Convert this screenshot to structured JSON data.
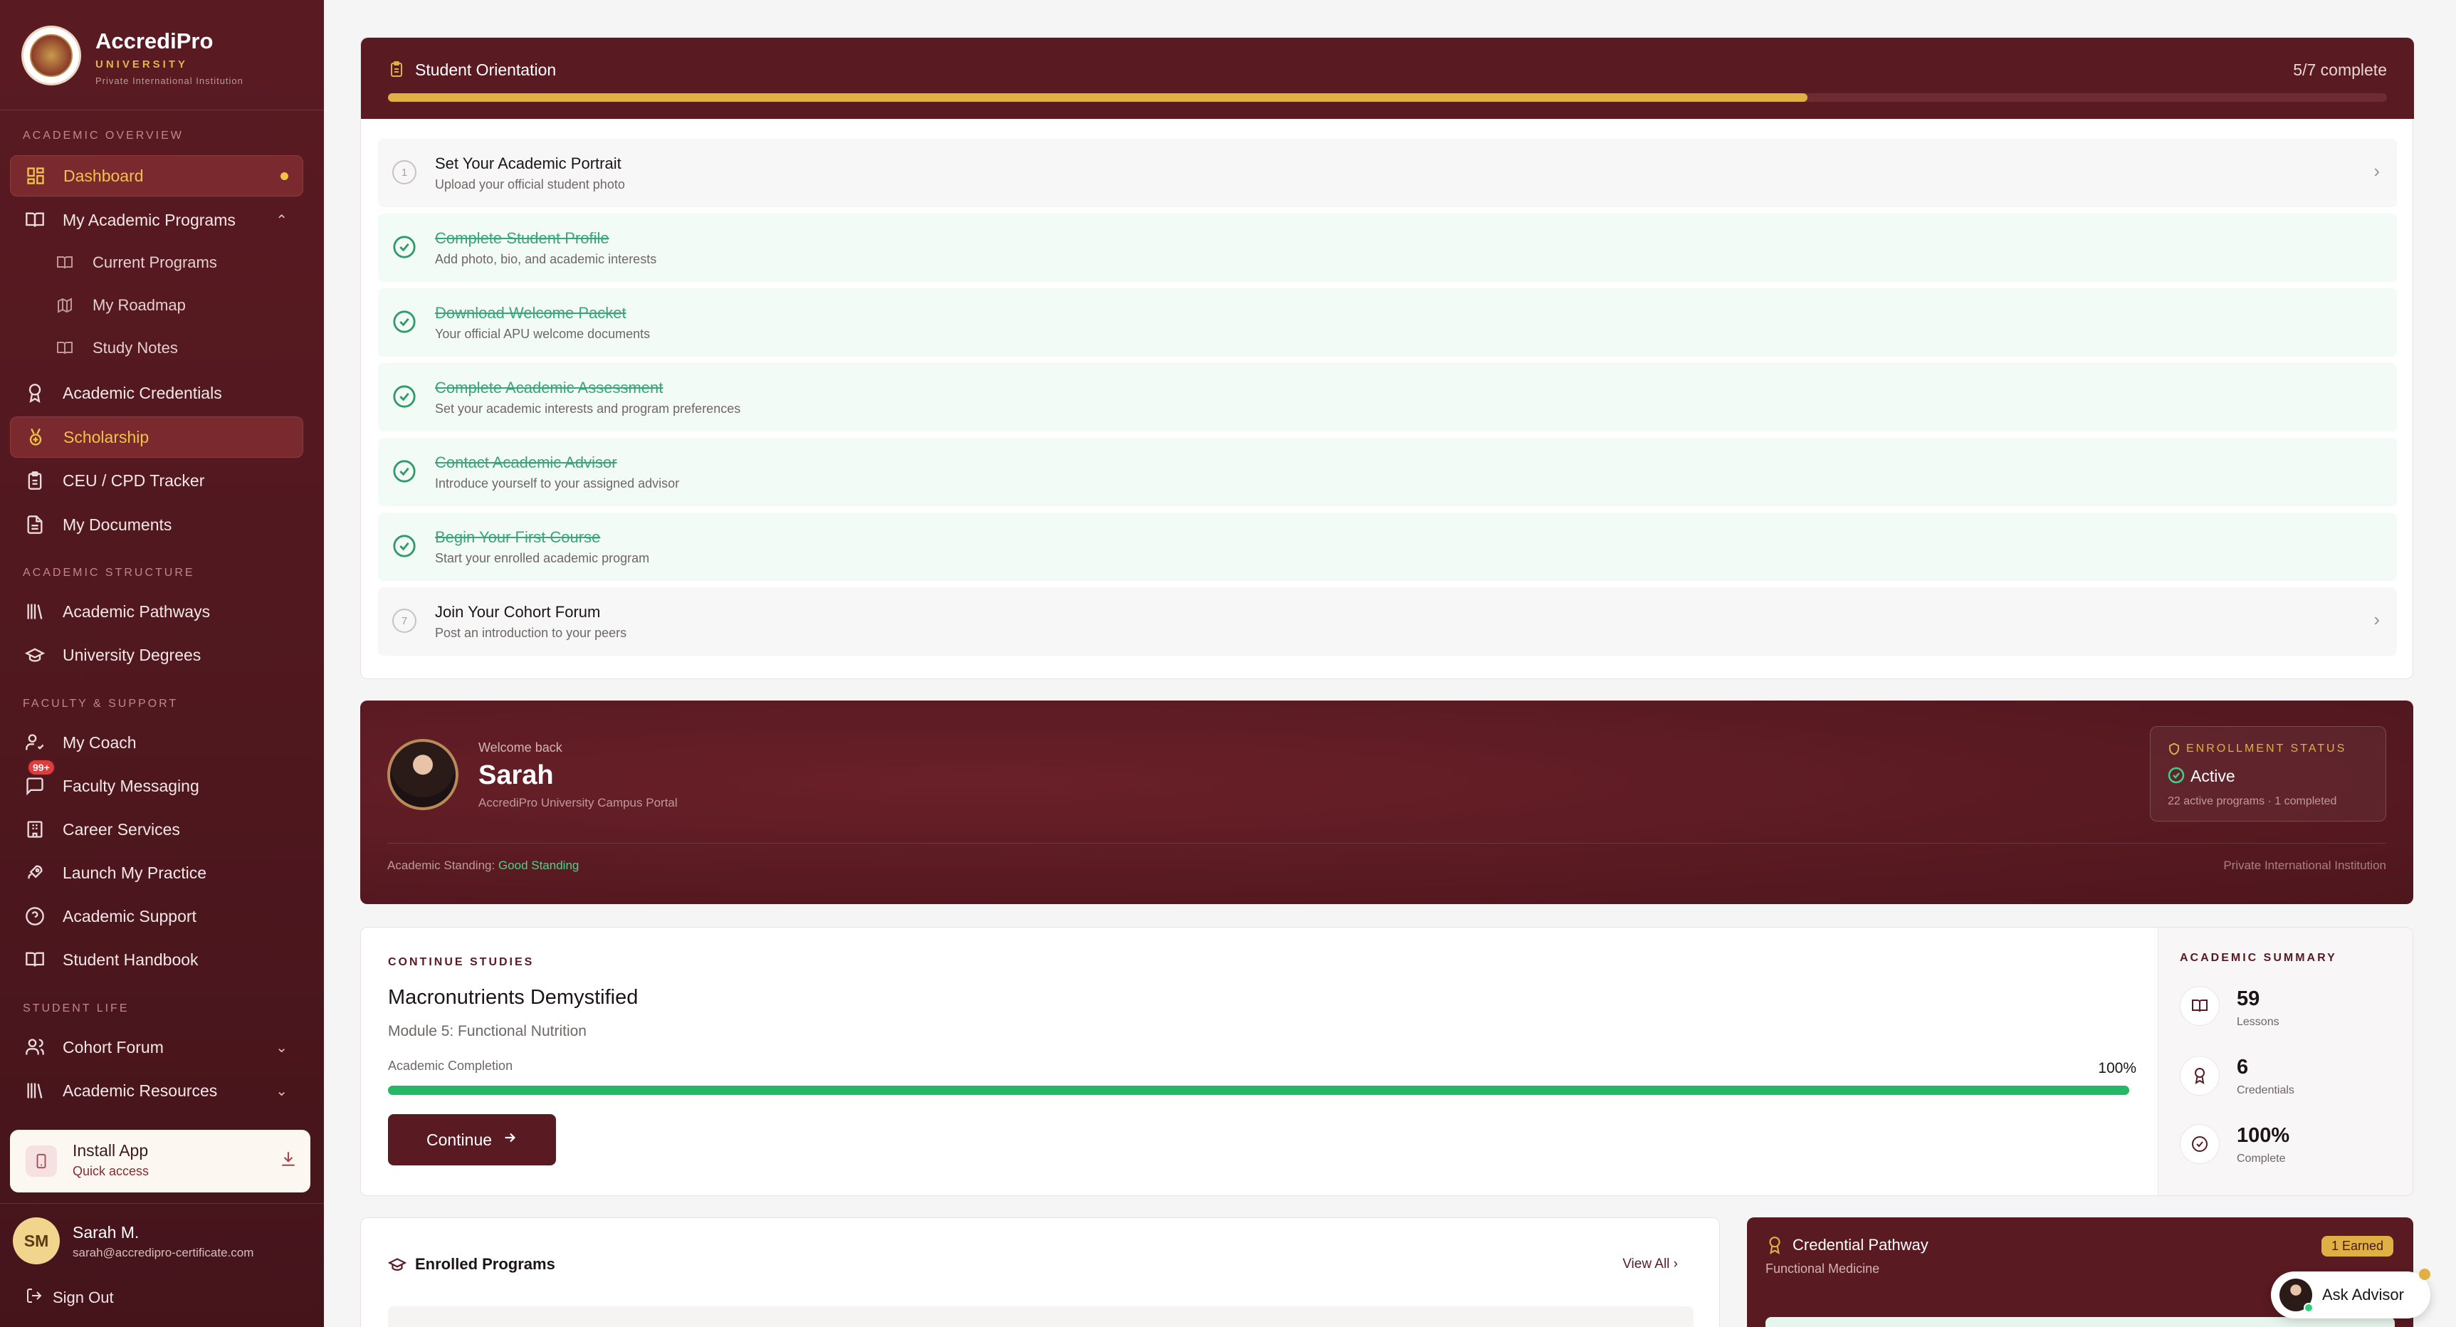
{
  "brand": {
    "name": "AccrediPro",
    "subtitle": "UNIVERSITY",
    "tagline": "Private International Institution"
  },
  "sidebar": {
    "sections": {
      "overview": "ACADEMIC OVERVIEW",
      "structure": "ACADEMIC STRUCTURE",
      "faculty": "FACULTY & SUPPORT",
      "life": "STUDENT LIFE"
    },
    "items": {
      "dashboard": "Dashboard",
      "programs": "My Academic Programs",
      "current": "Current Programs",
      "roadmap": "My Roadmap",
      "notes": "Study Notes",
      "credentials": "Academic Credentials",
      "scholarship": "Scholarship",
      "ceu": "CEU / CPD Tracker",
      "documents": "My Documents",
      "pathways": "Academic Pathways",
      "degrees": "University Degrees",
      "coach": "My Coach",
      "messaging": "Faculty Messaging",
      "career": "Career Services",
      "practice": "Launch My Practice",
      "support": "Academic Support",
      "handbook": "Student Handbook",
      "forum": "Cohort Forum",
      "resources": "Academic Resources"
    },
    "messaging_badge": "99+",
    "install": {
      "title": "Install App",
      "subtitle": "Quick access"
    },
    "user": {
      "initials": "SM",
      "name": "Sarah M.",
      "email": "sarah@accredipro-certificate.com"
    },
    "signout": "Sign Out"
  },
  "orientation": {
    "title": "Student Orientation",
    "count": "5/7 complete",
    "progress": 0.71,
    "tasks": [
      {
        "num": "1",
        "title": "Set Your Academic Portrait",
        "desc": "Upload your official student photo",
        "done": false
      },
      {
        "title": "Complete Student Profile",
        "desc": "Add photo, bio, and academic interests",
        "done": true
      },
      {
        "title": "Download Welcome Packet",
        "desc": "Your official APU welcome documents",
        "done": true
      },
      {
        "title": "Complete Academic Assessment",
        "desc": "Set your academic interests and program preferences",
        "done": true
      },
      {
        "title": "Contact Academic Advisor",
        "desc": "Introduce yourself to your assigned advisor",
        "done": true
      },
      {
        "title": "Begin Your First Course",
        "desc": "Start your enrolled academic program",
        "done": true
      },
      {
        "num": "7",
        "title": "Join Your Cohort Forum",
        "desc": "Post an introduction to your peers",
        "done": false
      }
    ]
  },
  "welcome": {
    "greeting": "Welcome back",
    "name": "Sarah",
    "portal": "AccrediPro University Campus Portal",
    "standing_label": "Academic Standing:",
    "standing_value": "Good Standing",
    "institution": "Private International Institution",
    "enrollment": {
      "heading": "ENROLLMENT STATUS",
      "status": "Active",
      "detail": "22 active programs · 1 completed"
    }
  },
  "continue_studies": {
    "heading": "CONTINUE STUDIES",
    "course": "Macronutrients Demystified",
    "module": "Module 5: Functional Nutrition",
    "completion_label": "Academic Completion",
    "completion_pct": "100%",
    "completion": 1.0,
    "button": "Continue"
  },
  "summary": {
    "heading": "ACADEMIC SUMMARY",
    "stats": [
      {
        "value": "59",
        "label": "Lessons"
      },
      {
        "value": "6",
        "label": "Credentials"
      },
      {
        "value": "100%",
        "label": "Complete"
      }
    ]
  },
  "enrolled": {
    "title": "Enrolled Programs",
    "view_all": "View All"
  },
  "credential_pathway": {
    "title": "Credential Pathway",
    "subtitle": "Functional Medicine",
    "badge": "1 Earned"
  },
  "ask_advisor": "Ask Advisor",
  "colors": {
    "maroon": "#5a1a22",
    "gold": "#e0b044",
    "green": "#22b865"
  }
}
